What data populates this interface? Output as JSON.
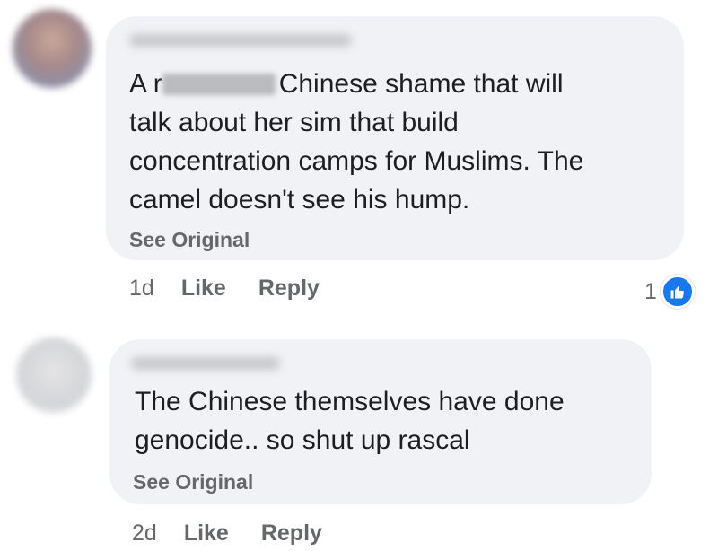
{
  "comments": [
    {
      "text_lines": [
        "Chinese shame that will",
        "talk about her sim that build",
        "concentration camps for Muslims. The",
        "camel doesn't see his hump."
      ],
      "first_line_prefix": "A r",
      "see_original": "See Original",
      "time": "1d",
      "like_label": "Like",
      "reply_label": "Reply",
      "reaction_count": "1"
    },
    {
      "text_lines": [
        "The Chinese themselves have done",
        "genocide.. so shut up rascal"
      ],
      "see_original": "See Original",
      "time": "2d",
      "like_label": "Like",
      "reply_label": "Reply"
    }
  ],
  "colors": {
    "bubble": "#f0f2f5",
    "secondary_text": "#65676b",
    "like_blue": "#1877f2"
  },
  "icons": {
    "reaction": "thumbs-up-icon"
  }
}
